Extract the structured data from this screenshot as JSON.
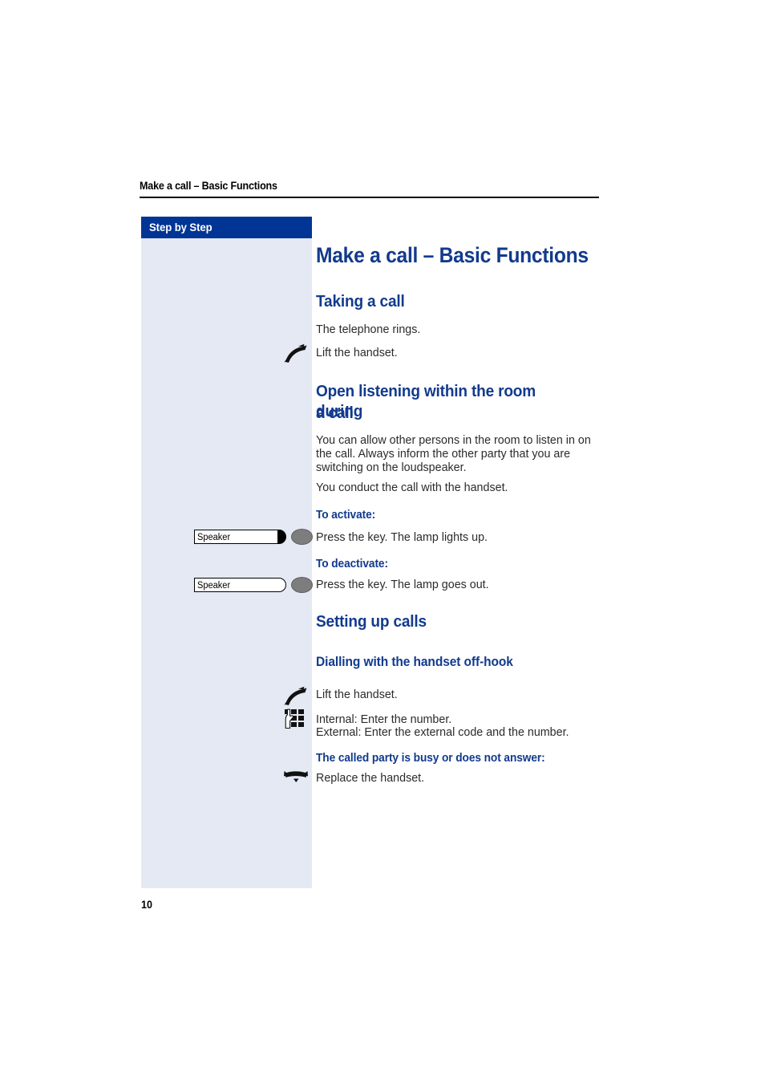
{
  "document": {
    "running_header": "Make a call – Basic Functions",
    "page_number": "10",
    "accent_blue": "#123a8e",
    "sidebar_header_blue": "#003595",
    "sidebar_fill": "#e4e9f4"
  },
  "sidebar": {
    "header_label": "Step by Step"
  },
  "main": {
    "title": "Make a call – Basic Functions",
    "sections": [
      {
        "heading": "Taking a call",
        "lines": [
          "The telephone rings.",
          "Lift the handset."
        ]
      },
      {
        "heading_line1": "Open listening within the room during",
        "heading_line2": "a call",
        "paragraph1_line1": "You can allow other persons in the room to listen in on",
        "paragraph1_line2": "the call. Always inform the other party that you are",
        "paragraph1_line3": "switching on the loudspeaker.",
        "paragraph2": "You conduct the call with the handset.",
        "activate_label": "To activate:",
        "activate_text": "Press the key. The lamp lights up.",
        "deactivate_label": "To deactivate:",
        "deactivate_text": "Press the key. The lamp goes out."
      },
      {
        "heading": "Setting up calls",
        "subheading": "Dialling with the handset off-hook",
        "lift_text": "Lift the handset.",
        "enter_line1": "Internal: Enter the number.",
        "enter_line2": "External: Enter the external code and the number.",
        "busy_label": "The called party is busy or does not answer:",
        "replace_text": "Replace the handset."
      }
    ]
  },
  "keys": {
    "speaker_activate": {
      "label": "Speaker",
      "lamp_state": "on"
    },
    "speaker_deactivate": {
      "label": "Speaker",
      "lamp_state": "off"
    }
  },
  "icons": {
    "lift_handset": "handset-lift-icon",
    "replace_handset": "handset-replace-icon",
    "keypad": "keypad-hand-icon"
  }
}
